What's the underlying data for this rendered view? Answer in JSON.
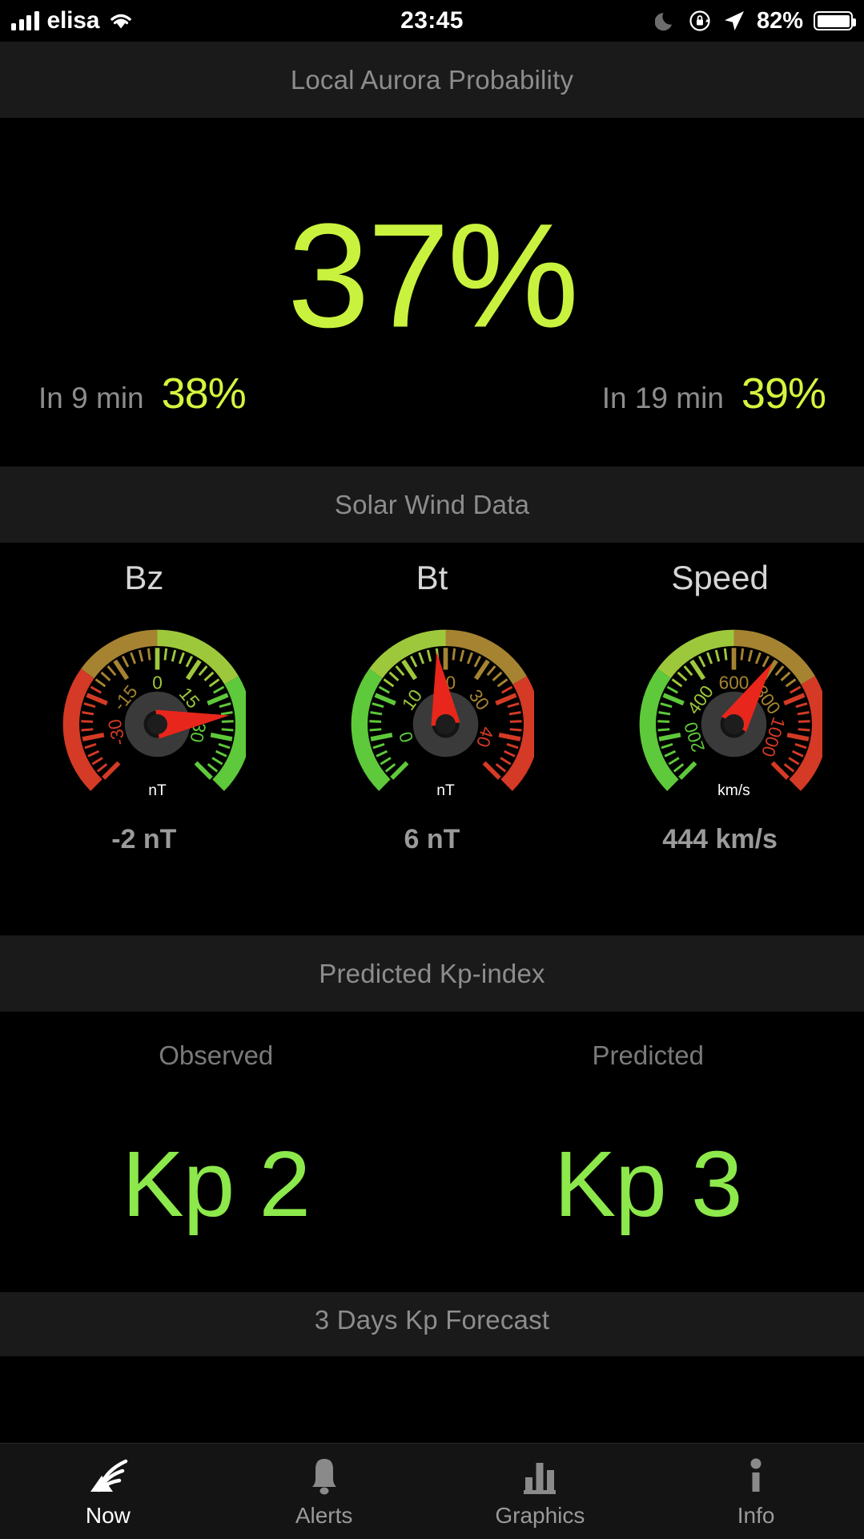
{
  "status_bar": {
    "carrier": "elisa",
    "time": "23:45",
    "battery_percent": "82%",
    "icons": [
      "signal-bars-icon",
      "wifi-icon",
      "moon-dnd-icon",
      "rotation-lock-icon",
      "location-arrow-icon",
      "battery-icon"
    ]
  },
  "aurora": {
    "header": "Local Aurora Probability",
    "current": "37%",
    "forecast_left_label": "In 9 min",
    "forecast_left_value": "38%",
    "forecast_right_label": "In 19 min",
    "forecast_right_value": "39%",
    "accent": "#c9f23e"
  },
  "solar_wind": {
    "header": "Solar Wind Data",
    "gauges": [
      {
        "title": "Bz",
        "unit": "nT",
        "value_text": "-2 nT",
        "value": -2,
        "min": -40,
        "max": 40,
        "ticks": [
          "-30",
          "-15",
          "0",
          "15",
          "30"
        ],
        "tick_values": [
          -30,
          -15,
          0,
          15,
          30
        ],
        "needle_angle": -7
      },
      {
        "title": "Bt",
        "unit": "nT",
        "value_text": "6 nT",
        "value": 6,
        "min": -5,
        "max": 45,
        "ticks": [
          "0",
          "10",
          "20",
          "30",
          "40"
        ],
        "tick_values": [
          0,
          10,
          20,
          30,
          40
        ],
        "needle_angle": -97
      },
      {
        "title": "Speed",
        "unit": "km/s",
        "value_text": "444 km/s",
        "value": 444,
        "min": 100,
        "max": 1100,
        "ticks": [
          "200",
          "400",
          "600",
          "800",
          "1000"
        ],
        "tick_values": [
          200,
          400,
          600,
          800,
          1000
        ],
        "needle_angle": -58
      }
    ]
  },
  "kp": {
    "header": "Predicted Kp-index",
    "observed_label": "Observed",
    "observed_value": "Kp 2",
    "predicted_label": "Predicted",
    "predicted_value": "Kp 3",
    "accent": "#8ce84b"
  },
  "forecast": {
    "header": "3 Days Kp Forecast"
  },
  "tabbar": {
    "tabs": [
      {
        "label": "Now",
        "icon": "aurora-icon",
        "active": true
      },
      {
        "label": "Alerts",
        "icon": "bell-icon",
        "active": false
      },
      {
        "label": "Graphics",
        "icon": "bar-chart-icon",
        "active": false
      },
      {
        "label": "Info",
        "icon": "info-icon",
        "active": false
      }
    ]
  }
}
